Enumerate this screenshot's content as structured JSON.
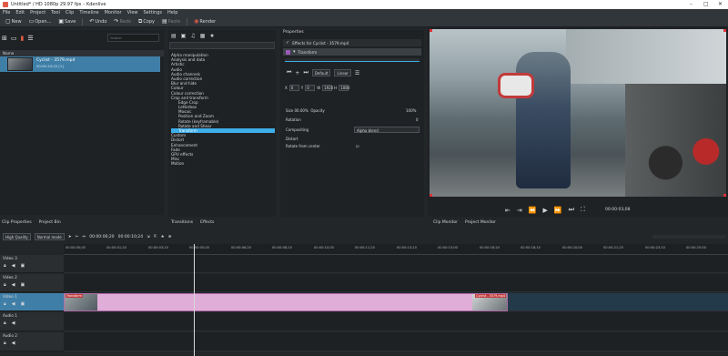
{
  "window": {
    "title": "Untitled* / HD 1080p 29.97 fps – Kdenlive"
  },
  "menu": [
    "File",
    "Edit",
    "Project",
    "Tool",
    "Clip",
    "Timeline",
    "Monitor",
    "View",
    "Settings",
    "Help"
  ],
  "toolbar": {
    "new": "New",
    "open": "Open...",
    "save": "Save",
    "undo": "Undo",
    "redo": "Redo",
    "copy": "Copy",
    "paste": "Paste",
    "render": "Render"
  },
  "bin": {
    "search_placeholder": "Search",
    "column_name": "Name",
    "clip_name": "Cyclist - 3579.mp4",
    "clip_meta": "00:00:10;20 [1]"
  },
  "effects": {
    "tree": [
      {
        "label": "Alpha manipulation",
        "sub": false
      },
      {
        "label": "Analysis and data",
        "sub": false
      },
      {
        "label": "Artistic",
        "sub": false
      },
      {
        "label": "Audio",
        "sub": false
      },
      {
        "label": "Audio channels",
        "sub": false
      },
      {
        "label": "Audio correction",
        "sub": false
      },
      {
        "label": "Blur and hide",
        "sub": false
      },
      {
        "label": "Colour",
        "sub": false
      },
      {
        "label": "Colour correction",
        "sub": false
      },
      {
        "label": "Crop and transform",
        "sub": false
      },
      {
        "label": "Edge Crop",
        "sub": true
      },
      {
        "label": "Letterbox",
        "sub": true
      },
      {
        "label": "Mosaic",
        "sub": true
      },
      {
        "label": "Position and Zoom",
        "sub": true
      },
      {
        "label": "Rotate (keyframable)",
        "sub": true
      },
      {
        "label": "Rotate and Shear",
        "sub": true
      },
      {
        "label": "Transform",
        "sub": true,
        "selected": true
      },
      {
        "label": "Custom",
        "sub": false
      },
      {
        "label": "Distort",
        "sub": false
      },
      {
        "label": "Enhancement",
        "sub": false
      },
      {
        "label": "Fade",
        "sub": false
      },
      {
        "label": "GPU effects",
        "sub": false
      },
      {
        "label": "Misc",
        "sub": false
      },
      {
        "label": "Motion",
        "sub": false
      }
    ],
    "tab_transitions": "Transitions",
    "tab_effects": "Effects"
  },
  "properties": {
    "title": "Properties",
    "effects_for": "Effects for Cyclist - 3579.mp4",
    "effect": "Transform",
    "interp": "Default",
    "ease": "Linear",
    "geo": {
      "x_label": "X",
      "x": "0",
      "y_label": "Y",
      "y": "0",
      "w_label": "W",
      "w": "1920",
      "h_label": "H",
      "h": "1080"
    },
    "size_label": "Size",
    "size": "00.00%",
    "opacity_label": "Opacity",
    "opacity": "100%",
    "rotation_label": "Rotation",
    "rotation": "0",
    "compositing_label": "Compositing",
    "compositing": "Alpha blend",
    "distort_label": "Distort",
    "rotate_center_label": "Rotate from center"
  },
  "tabs_left": {
    "clip_properties": "Clip Properties",
    "project_bin": "Project Bin"
  },
  "monitor": {
    "timecode": "00:00:03;08",
    "tab_clip": "Clip Monitor",
    "tab_project": "Project Monitor"
  },
  "timeline": {
    "quality": "High Quality",
    "mode": "Normal mode",
    "position": "00:00:06;20",
    "duration": "00:00:10;24",
    "ticks": [
      "00:00:00;00",
      "00:00:01;20",
      "00:00:03;10",
      "00:00:05;00",
      "00:00:06;20",
      "00:00:08;10",
      "00:00:10;00",
      "00:00:11;20",
      "00:00:13;10",
      "00:00:15;00",
      "00:00:16;20",
      "00:00:18;10",
      "00:00:20;00",
      "00:00:21;20",
      "00:00:23;10",
      "00:00:25;00"
    ],
    "tracks": [
      "Video 3",
      "Video 2",
      "Video 1",
      "Audio 1",
      "Audio 2"
    ],
    "clip_label_left": "Transform",
    "clip_label_right": "Cyclist - 3579.mp4"
  }
}
